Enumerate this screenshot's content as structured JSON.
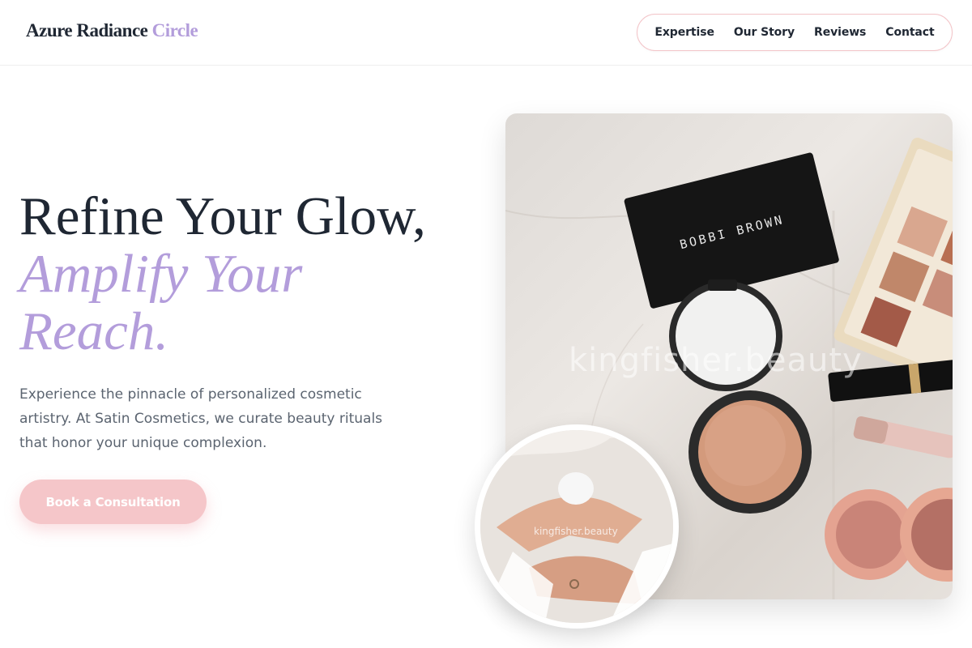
{
  "header": {
    "logo_main": "Azure Radiance",
    "logo_accent": "Circle",
    "nav": [
      "Expertise",
      "Our Story",
      "Reviews",
      "Contact"
    ]
  },
  "hero": {
    "headline_line1": "Refine Your Glow,",
    "headline_em1": "Amplify Your",
    "headline_em2": "Reach.",
    "description": "Experience the pinnacle of personalized cosmetic artistry. At Satin Cosmetics, we curate beauty rituals that honor your unique complexion.",
    "cta_label": "Book a Consultation"
  },
  "images": {
    "main_watermark": "kingfisher.beauty",
    "circle_watermark": "kingfisher.beauty",
    "compact_brand": "BOBBI BROWN"
  },
  "colors": {
    "accent_lavender": "#b39ddb",
    "cta_pink": "#f5c6c9",
    "text_dark": "#1f2733"
  }
}
